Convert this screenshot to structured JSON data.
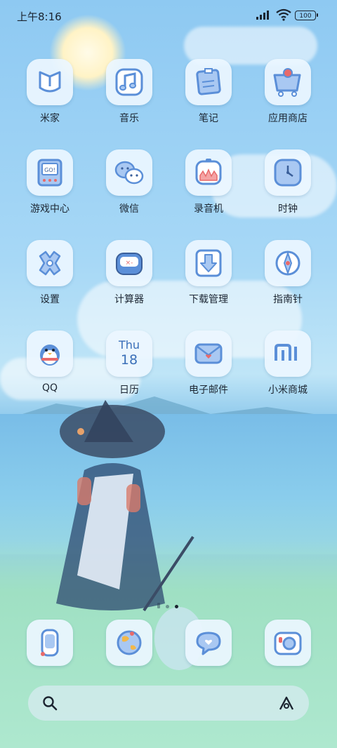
{
  "status_bar": {
    "time": "上午8:16",
    "battery": "100"
  },
  "apps": [
    {
      "label": "米家",
      "icon": "mi-home-icon"
    },
    {
      "label": "音乐",
      "icon": "music-icon"
    },
    {
      "label": "笔记",
      "icon": "notes-icon"
    },
    {
      "label": "应用商店",
      "icon": "app-store-icon"
    },
    {
      "label": "游戏中心",
      "icon": "game-center-icon"
    },
    {
      "label": "微信",
      "icon": "wechat-icon"
    },
    {
      "label": "录音机",
      "icon": "recorder-icon"
    },
    {
      "label": "时钟",
      "icon": "clock-icon"
    },
    {
      "label": "设置",
      "icon": "settings-icon"
    },
    {
      "label": "计算器",
      "icon": "calculator-icon"
    },
    {
      "label": "下载管理",
      "icon": "download-icon"
    },
    {
      "label": "指南针",
      "icon": "compass-icon"
    },
    {
      "label": "QQ",
      "icon": "qq-icon"
    },
    {
      "label": "日历",
      "icon": "calendar-icon",
      "day": "Thu",
      "date": "18"
    },
    {
      "label": "电子邮件",
      "icon": "mail-icon"
    },
    {
      "label": "小米商城",
      "icon": "mi-store-icon"
    }
  ],
  "icon_text": {
    "game_center": "GO!"
  },
  "dock": [
    {
      "icon": "phone-icon"
    },
    {
      "icon": "browser-icon"
    },
    {
      "icon": "messages-icon"
    },
    {
      "icon": "camera-icon"
    }
  ],
  "page_indicator": {
    "pages": 2,
    "current": 2
  },
  "colors": {
    "icon_blue": "#5b8fd8",
    "icon_fill": "#a9c8f2",
    "tile_bg": "#ecf6ff",
    "accent_red": "#e86a6a"
  }
}
